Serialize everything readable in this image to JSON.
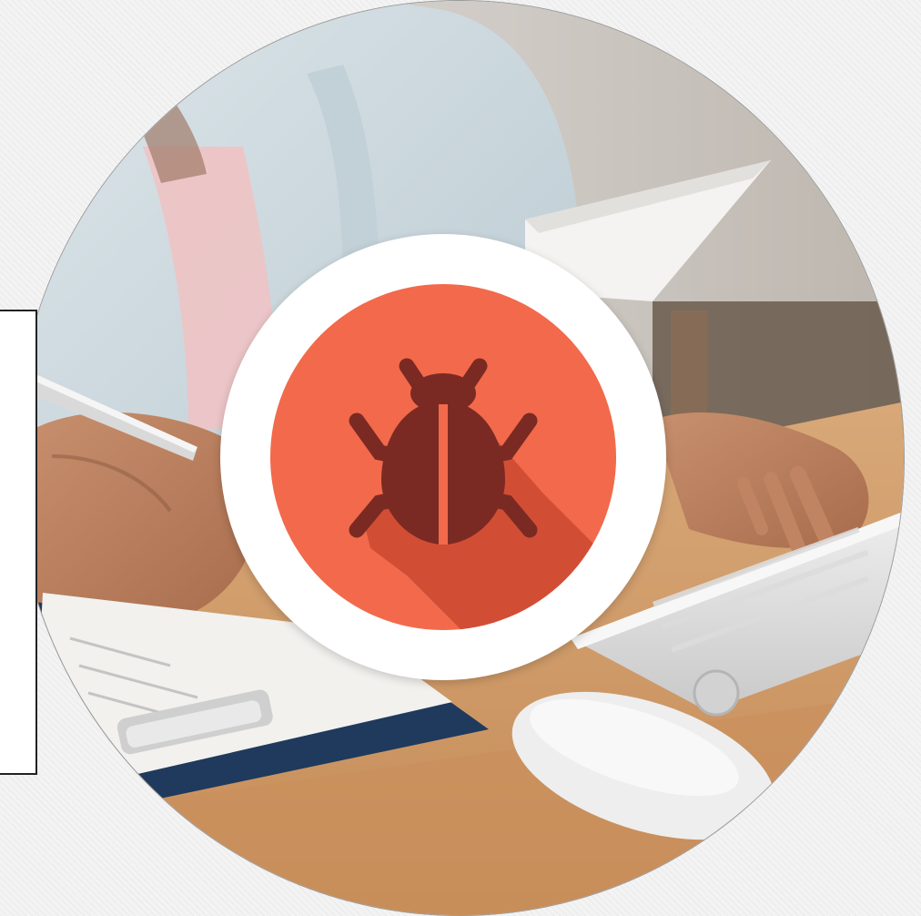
{
  "illustration": {
    "photo_subject": "person-writing-at-desk-with-keyboard",
    "center_icon": "bug-icon",
    "colors": {
      "badge_fill": "#f26a4b",
      "badge_shadow": "#cd4b33",
      "bug_color": "#7b2a23",
      "ring_color": "#ffffff"
    }
  }
}
